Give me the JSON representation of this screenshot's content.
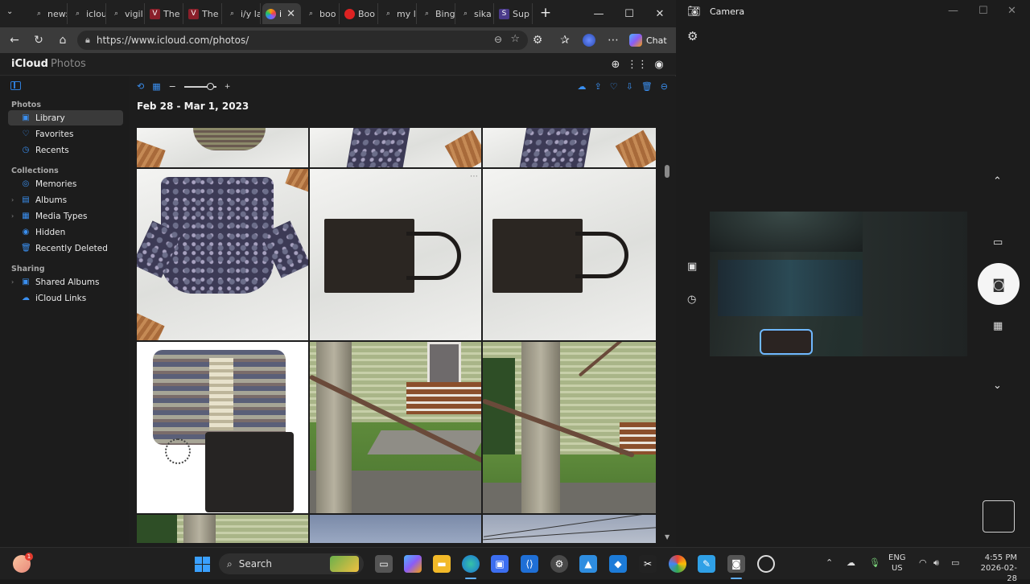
{
  "browser": {
    "tabs": [
      {
        "label": "new:",
        "favicon": "search"
      },
      {
        "label": "iclou",
        "favicon": "search"
      },
      {
        "label": "vigil",
        "favicon": "search"
      },
      {
        "label": "The",
        "favicon": "vi"
      },
      {
        "label": "The",
        "favicon": "vi"
      },
      {
        "label": "i/y la",
        "favicon": "search"
      },
      {
        "label": "i",
        "favicon": "icloud",
        "active": true
      },
      {
        "label": "boo",
        "favicon": "search"
      },
      {
        "label": "Boo",
        "favicon": "red-dot"
      },
      {
        "label": "my li",
        "favicon": "search"
      },
      {
        "label": "Bing",
        "favicon": "search"
      },
      {
        "label": "sika",
        "favicon": "search"
      },
      {
        "label": "Sup",
        "favicon": "s"
      }
    ],
    "new_tab_symbol": "+",
    "url": "https://www.icloud.com/photos/",
    "chat_label": "Chat"
  },
  "icloud": {
    "brand": "iCloud",
    "brand_sub": "Photos",
    "sidebar": {
      "sections": [
        {
          "title": "Photos",
          "items": [
            {
              "label": "Library",
              "icon": "photos-icon",
              "selected": true
            },
            {
              "label": "Favorites",
              "icon": "heart-icon"
            },
            {
              "label": "Recents",
              "icon": "clock-icon"
            }
          ]
        },
        {
          "title": "Collections",
          "items": [
            {
              "label": "Memories",
              "icon": "memories-icon"
            },
            {
              "label": "Albums",
              "icon": "album-icon",
              "expandable": true
            },
            {
              "label": "Media Types",
              "icon": "media-types-icon",
              "expandable": true
            },
            {
              "label": "Hidden",
              "icon": "eye-slash-icon"
            },
            {
              "label": "Recently Deleted",
              "icon": "trash-icon"
            }
          ]
        },
        {
          "title": "Sharing",
          "items": [
            {
              "label": "Shared Albums",
              "icon": "shared-album-icon",
              "expandable": true
            },
            {
              "label": "iCloud Links",
              "icon": "cloud-link-icon"
            }
          ]
        }
      ]
    },
    "date_range": "Feb 28 - Mar 1, 2023"
  },
  "camera": {
    "title": "Camera"
  },
  "taskbar": {
    "search_label": "Search",
    "lang_line1": "ENG",
    "lang_line2": "US",
    "time": "4:55 PM",
    "date": "2026-02-28",
    "notification_badge": "1"
  }
}
